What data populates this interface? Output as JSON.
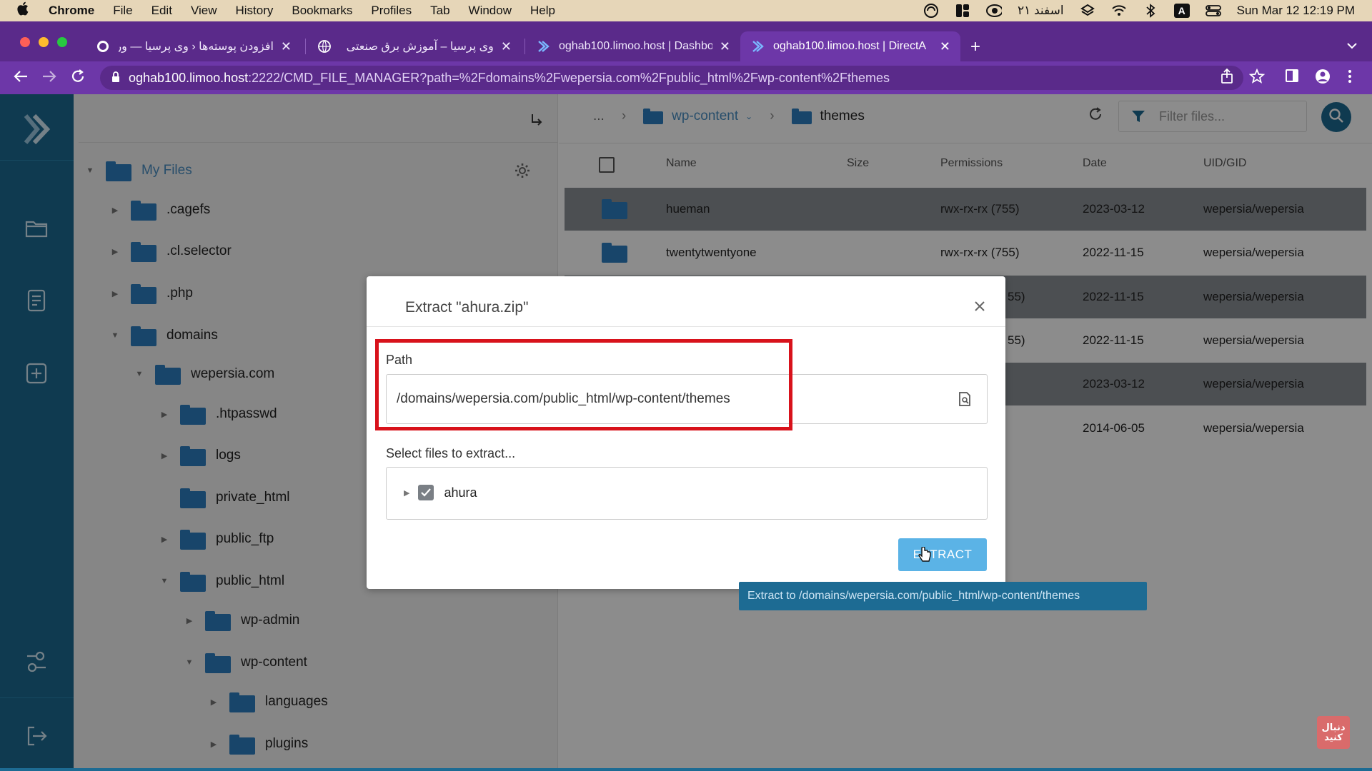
{
  "menubar": {
    "app": "Chrome",
    "items": [
      "File",
      "Edit",
      "View",
      "History",
      "Bookmarks",
      "Profiles",
      "Tab",
      "Window",
      "Help"
    ],
    "persian_date": "۲۱ اسفند",
    "input_badge": "A",
    "datetime": "Sun Mar 12  12:19 PM"
  },
  "tabs": [
    {
      "title": "افزودن پوسته‌ها ‹ وی پرسیا — وردپ...",
      "active": false
    },
    {
      "title": "وی پرسیا – آموزش برق صنعتی",
      "active": false
    },
    {
      "title": "oghab100.limoo.host | Dashbo",
      "active": false
    },
    {
      "title": "oghab100.limoo.host | DirectA",
      "active": true
    }
  ],
  "address": {
    "host": "oghab100.limoo.host",
    "rest": ":2222/CMD_FILE_MANAGER?path=%2Fdomains%2Fwepersia.com%2Fpublic_html%2Fwp-content%2Fthemes"
  },
  "tree": {
    "root": "My Files",
    "items": [
      {
        "label": ".cagefs",
        "caret": "▶"
      },
      {
        "label": ".cl.selector",
        "caret": "▶"
      },
      {
        "label": ".php",
        "caret": "▶"
      },
      {
        "label": "domains",
        "caret": "▼"
      },
      {
        "label": "wepersia.com",
        "caret": "▼"
      },
      {
        "label": ".htpasswd",
        "caret": "▶"
      },
      {
        "label": "logs",
        "caret": "▶"
      },
      {
        "label": "private_html",
        "caret": ""
      },
      {
        "label": "public_ftp",
        "caret": "▶"
      },
      {
        "label": "public_html",
        "caret": "▼"
      },
      {
        "label": "wp-admin",
        "caret": "▶"
      },
      {
        "label": "wp-content",
        "caret": "▼"
      },
      {
        "label": "languages",
        "caret": "▶"
      },
      {
        "label": "plugins",
        "caret": "▶"
      }
    ]
  },
  "breadcrumb": {
    "ellipsis": "...",
    "parent": "wp-content",
    "current": "themes"
  },
  "filter_placeholder": "Filter files...",
  "columns": {
    "name": "Name",
    "size": "Size",
    "permissions": "Permissions",
    "date": "Date",
    "uid": "UID/GID"
  },
  "files": [
    {
      "name": "hueman",
      "perm": "rwx-rx-rx (755)",
      "date": "2023-03-12",
      "uid": "wepersia/wepersia"
    },
    {
      "name": "twentytwentyone",
      "perm": "rwx-rx-rx (755)",
      "date": "2022-11-15",
      "uid": "wepersia/wepersia"
    },
    {
      "name": "",
      "perm": "55)",
      "date": "2022-11-15",
      "uid": "wepersia/wepersia"
    },
    {
      "name": "",
      "perm": "55)",
      "date": "2022-11-15",
      "uid": "wepersia/wepersia"
    },
    {
      "name": "",
      "perm": "",
      "date": "2023-03-12",
      "uid": "wepersia/wepersia"
    },
    {
      "name": "",
      "perm": "",
      "date": "2014-06-05",
      "uid": "wepersia/wepersia"
    }
  ],
  "modal": {
    "title": "Extract \"ahura.zip\"",
    "path_label": "Path",
    "path_value": "/domains/wepersia.com/public_html/wp-content/themes",
    "select_label": "Select files to extract...",
    "item": "ahura",
    "extract_label": "EXTRACT",
    "tooltip": "Extract to /domains/wepersia.com/public_html/wp-content/themes"
  },
  "watermark": "دنبال کنید",
  "colors": {
    "accent": "#1d6b93",
    "highlight_box": "#d8121b",
    "button": "#5bb3e6",
    "browser_frame": "#6d37a8"
  }
}
